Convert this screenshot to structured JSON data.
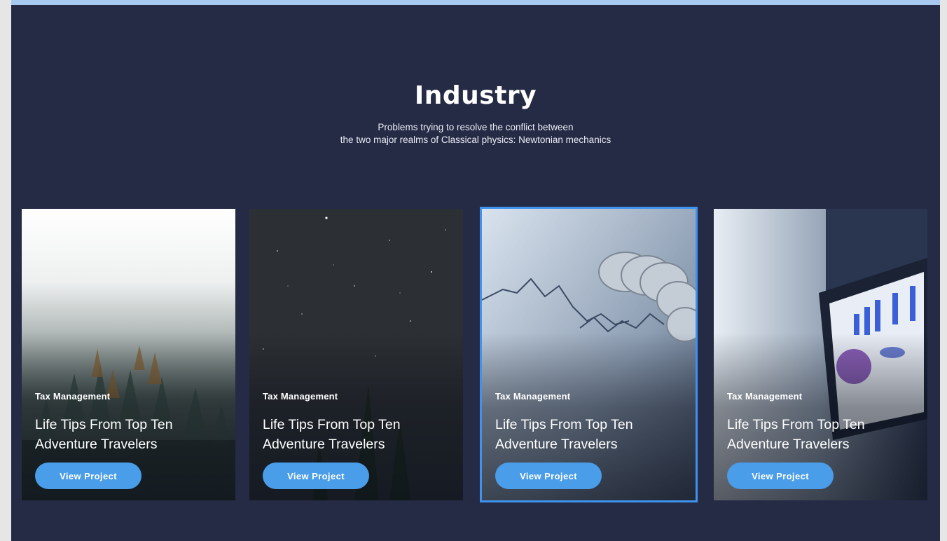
{
  "section": {
    "title": "Industry",
    "subtitle_line1": "Problems trying to resolve the conflict between",
    "subtitle_line2": "the two major realms of Classical physics: Newtonian mechanics"
  },
  "colors": {
    "background": "#252b45",
    "accent": "#4a9de8",
    "top_bar": "#a7c8ef"
  },
  "cards": [
    {
      "image": "misty-forest",
      "category": "Tax Management",
      "title": "Life Tips From Top Ten Adventure Travelers",
      "button": "View Project",
      "selected": false
    },
    {
      "image": "starry-night-sky",
      "category": "Tax Management",
      "title": "Life Tips From Top Ten Adventure Travelers",
      "button": "View Project",
      "selected": false
    },
    {
      "image": "coins-on-financial-chart",
      "category": "Tax Management",
      "title": "Life Tips From Top Ten Adventure Travelers",
      "button": "View Project",
      "selected": true
    },
    {
      "image": "businessman-with-laptop-charts",
      "category": "Tax Management",
      "title": "Life Tips From Top Ten Adventure Travelers",
      "button": "View Project",
      "selected": false
    }
  ]
}
